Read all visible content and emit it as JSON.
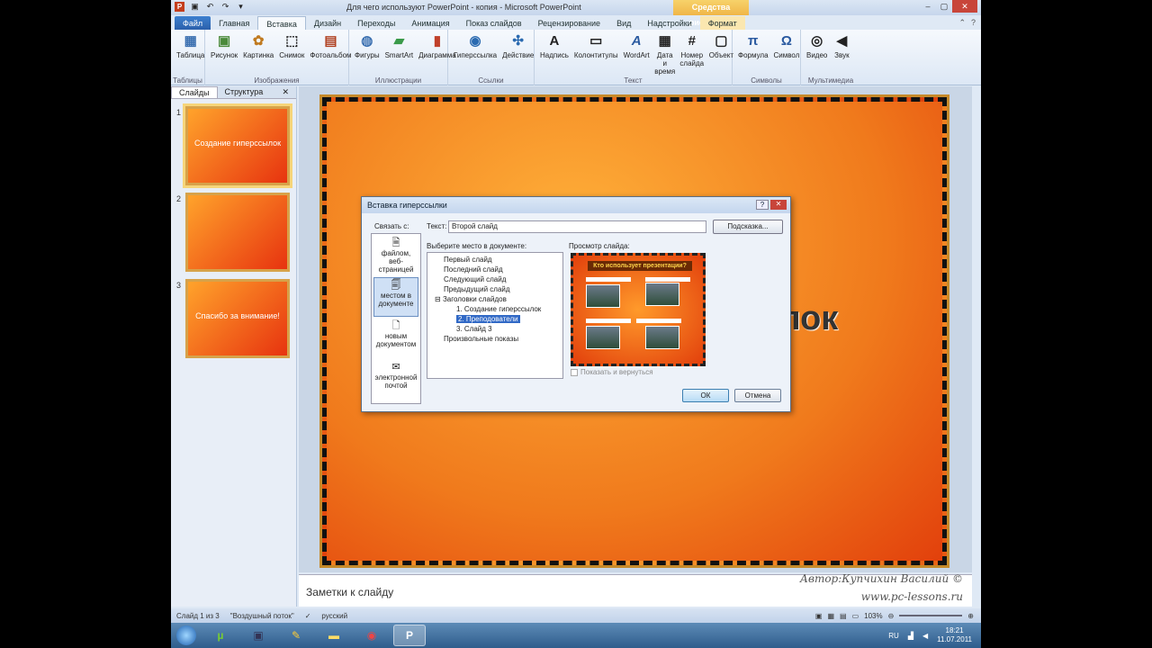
{
  "window": {
    "title": "Для чего используют PowerPoint - копия - Microsoft PowerPoint",
    "contextual": "Средства рисования"
  },
  "tabs": [
    "Файл",
    "Главная",
    "Вставка",
    "Дизайн",
    "Переходы",
    "Анимация",
    "Показ слайдов",
    "Рецензирование",
    "Вид",
    "Надстройки",
    "Формат"
  ],
  "ribbon": {
    "tables": {
      "caption": "Таблицы",
      "table": "Таблица"
    },
    "images": {
      "caption": "Изображения",
      "picture": "Рисунок",
      "clipart": "Картинка",
      "screenshot": "Снимок",
      "album": "Фотоальбом"
    },
    "illustrations": {
      "caption": "Иллюстрации",
      "shapes": "Фигуры",
      "smartart": "SmartArt",
      "chart": "Диаграмма"
    },
    "links": {
      "caption": "Ссылки",
      "hyperlink": "Гиперссылка",
      "action": "Действие"
    },
    "text": {
      "caption": "Текст",
      "textbox": "Надпись",
      "header": "Колонтитулы",
      "wordart": "WordArt",
      "datetime": "Дата и время",
      "slidenum": "Номер слайда",
      "object": "Объект"
    },
    "symbols": {
      "caption": "Символы",
      "equation": "Формула",
      "symbol": "Символ"
    },
    "media": {
      "caption": "Мультимедиа",
      "video": "Видео",
      "audio": "Звук"
    }
  },
  "leftpanel": {
    "tab_slides": "Слайды",
    "tab_outline": "Структура",
    "thumbs": [
      {
        "num": "1",
        "title": "Создание гиперссылок"
      },
      {
        "num": "2",
        "title": ""
      },
      {
        "num": "3",
        "title": "Спасибо за внимание!"
      }
    ]
  },
  "slide": {
    "title": "ылок"
  },
  "notes": {
    "text": "Заметки к слайду"
  },
  "watermark": {
    "line1": "Автор:Купчихин Василий ©",
    "line2": "www.pc-lessons.ru"
  },
  "status": {
    "slide": "Слайд 1 из 3",
    "theme": "\"Воздушный поток\"",
    "lang": "русский",
    "zoom": "103%"
  },
  "dialog": {
    "title": "Вставка гиперссылки",
    "link_to": "Связать с:",
    "sidebar": [
      "файлом, веб-страницей",
      "местом в документе",
      "новым документом",
      "электронной почтой"
    ],
    "text_label": "Текст:",
    "text_value": "Второй слайд",
    "hint": "Подсказка...",
    "place_label": "Выберите место в документе:",
    "tree": [
      "Первый слайд",
      "Последний слайд",
      "Следующий слайд",
      "Предыдущий слайд",
      "Заголовки слайдов",
      "1. Создание гиперссылок",
      "2. Преподователи",
      "3. Слайд 3",
      "Произвольные показы"
    ],
    "preview_label": "Просмотр слайда:",
    "preview_title": "Кто использует презентации?",
    "show_back": "Показать и вернуться",
    "ok": "ОК",
    "cancel": "Отмена"
  },
  "taskbar": {
    "lang": "RU",
    "time": "18:21",
    "date": "11.07.2011"
  }
}
